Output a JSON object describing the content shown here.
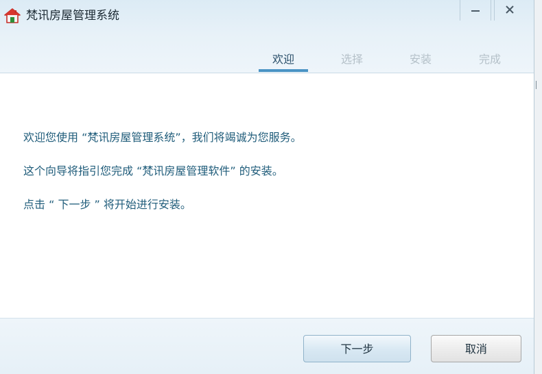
{
  "window": {
    "title": "梵讯房屋管理系统",
    "minimize_glyph": "–",
    "close_glyph": "✕"
  },
  "steps": [
    {
      "label": "欢迎",
      "active": true
    },
    {
      "label": "选择",
      "active": false
    },
    {
      "label": "安装",
      "active": false
    },
    {
      "label": "完成",
      "active": false
    }
  ],
  "content": {
    "lines": [
      "欢迎您使用 “梵讯房屋管理系统”，我们将竭诚为您服务。",
      "这个向导将指引您完成 “梵讯房屋管理软件” 的安装。",
      "点击 “ 下一步 ” 将开始进行安装。"
    ]
  },
  "buttons": {
    "next_label": "下一步",
    "cancel_label": "取消"
  },
  "icons": {
    "app": "house-icon",
    "minimize": "minimize-icon",
    "close": "close-icon"
  },
  "colors": {
    "accent": "#4a93c4",
    "text_blue": "#1f5c7a",
    "header_bg": "#e7f1f8"
  }
}
